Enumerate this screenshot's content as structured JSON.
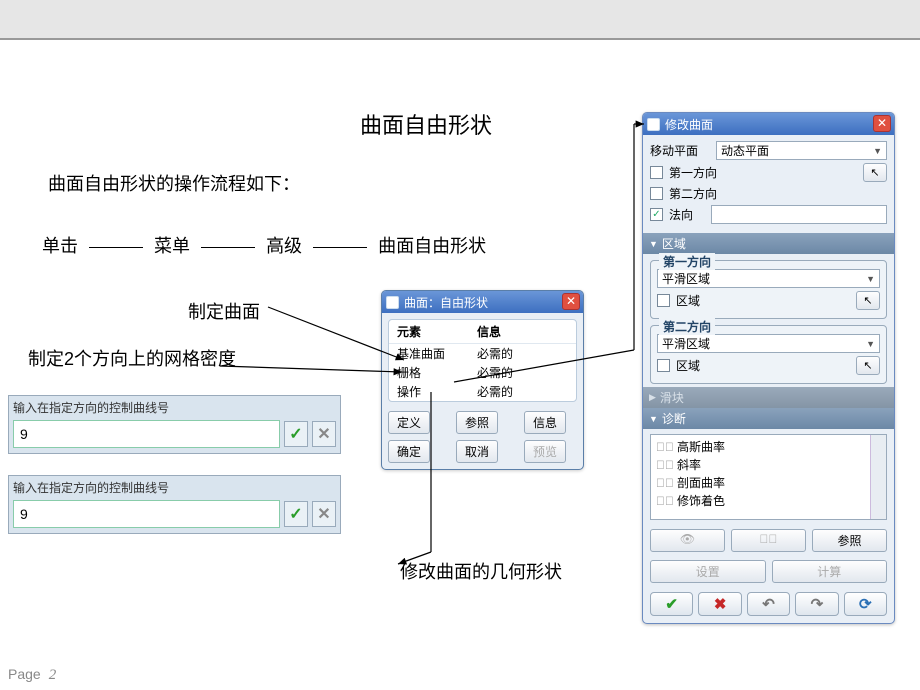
{
  "page": {
    "label": "Page",
    "number": "2"
  },
  "title": "曲面自由形状",
  "intro": "曲面自由形状的操作流程如下：",
  "flow": {
    "a": "单击",
    "b": "菜单",
    "c": "高级",
    "d": "曲面自由形状"
  },
  "labels": {
    "make_surface": "制定曲面",
    "grid_density": "制定2个方向上的网格密度",
    "modify_geom": "修改曲面的几何形状"
  },
  "input_block": {
    "label": "输入在指定方向的控制曲线号",
    "value1": "9",
    "value2": "9"
  },
  "dlg_free": {
    "title": "曲面：自由形状",
    "col1": "元素",
    "col2": "信息",
    "rows": [
      {
        "a": "基准曲面",
        "b": "必需的"
      },
      {
        "a": "栅格",
        "b": "必需的"
      },
      {
        "a": "操作",
        "b": "必需的"
      }
    ],
    "btn_define": "定义",
    "btn_ref": "参照",
    "btn_info": "信息",
    "btn_ok": "确定",
    "btn_cancel": "取消",
    "btn_preview": "预览"
  },
  "dlg_mod": {
    "title": "修改曲面",
    "move_plane_label": "移动平面",
    "move_plane_value": "动态平面",
    "dir1": "第一方向",
    "dir2": "第二方向",
    "normal": "法向",
    "normal_checked": true,
    "sect_region": "区域",
    "grp1_title": "第一方向",
    "grp1_combo": "平滑区域",
    "grp1_chk": "区域",
    "grp2_title": "第二方向",
    "grp2_combo": "平滑区域",
    "grp2_chk": "区域",
    "sect_slide": "滑块",
    "sect_diag": "诊断",
    "diag_items": [
      "高斯曲率",
      "斜率",
      "剖面曲率",
      "修饰着色"
    ],
    "btn_show": "👁",
    "btn_hide": "👁",
    "btn_ref": "参照",
    "btn_settings": "设置",
    "btn_calc": "计算"
  }
}
